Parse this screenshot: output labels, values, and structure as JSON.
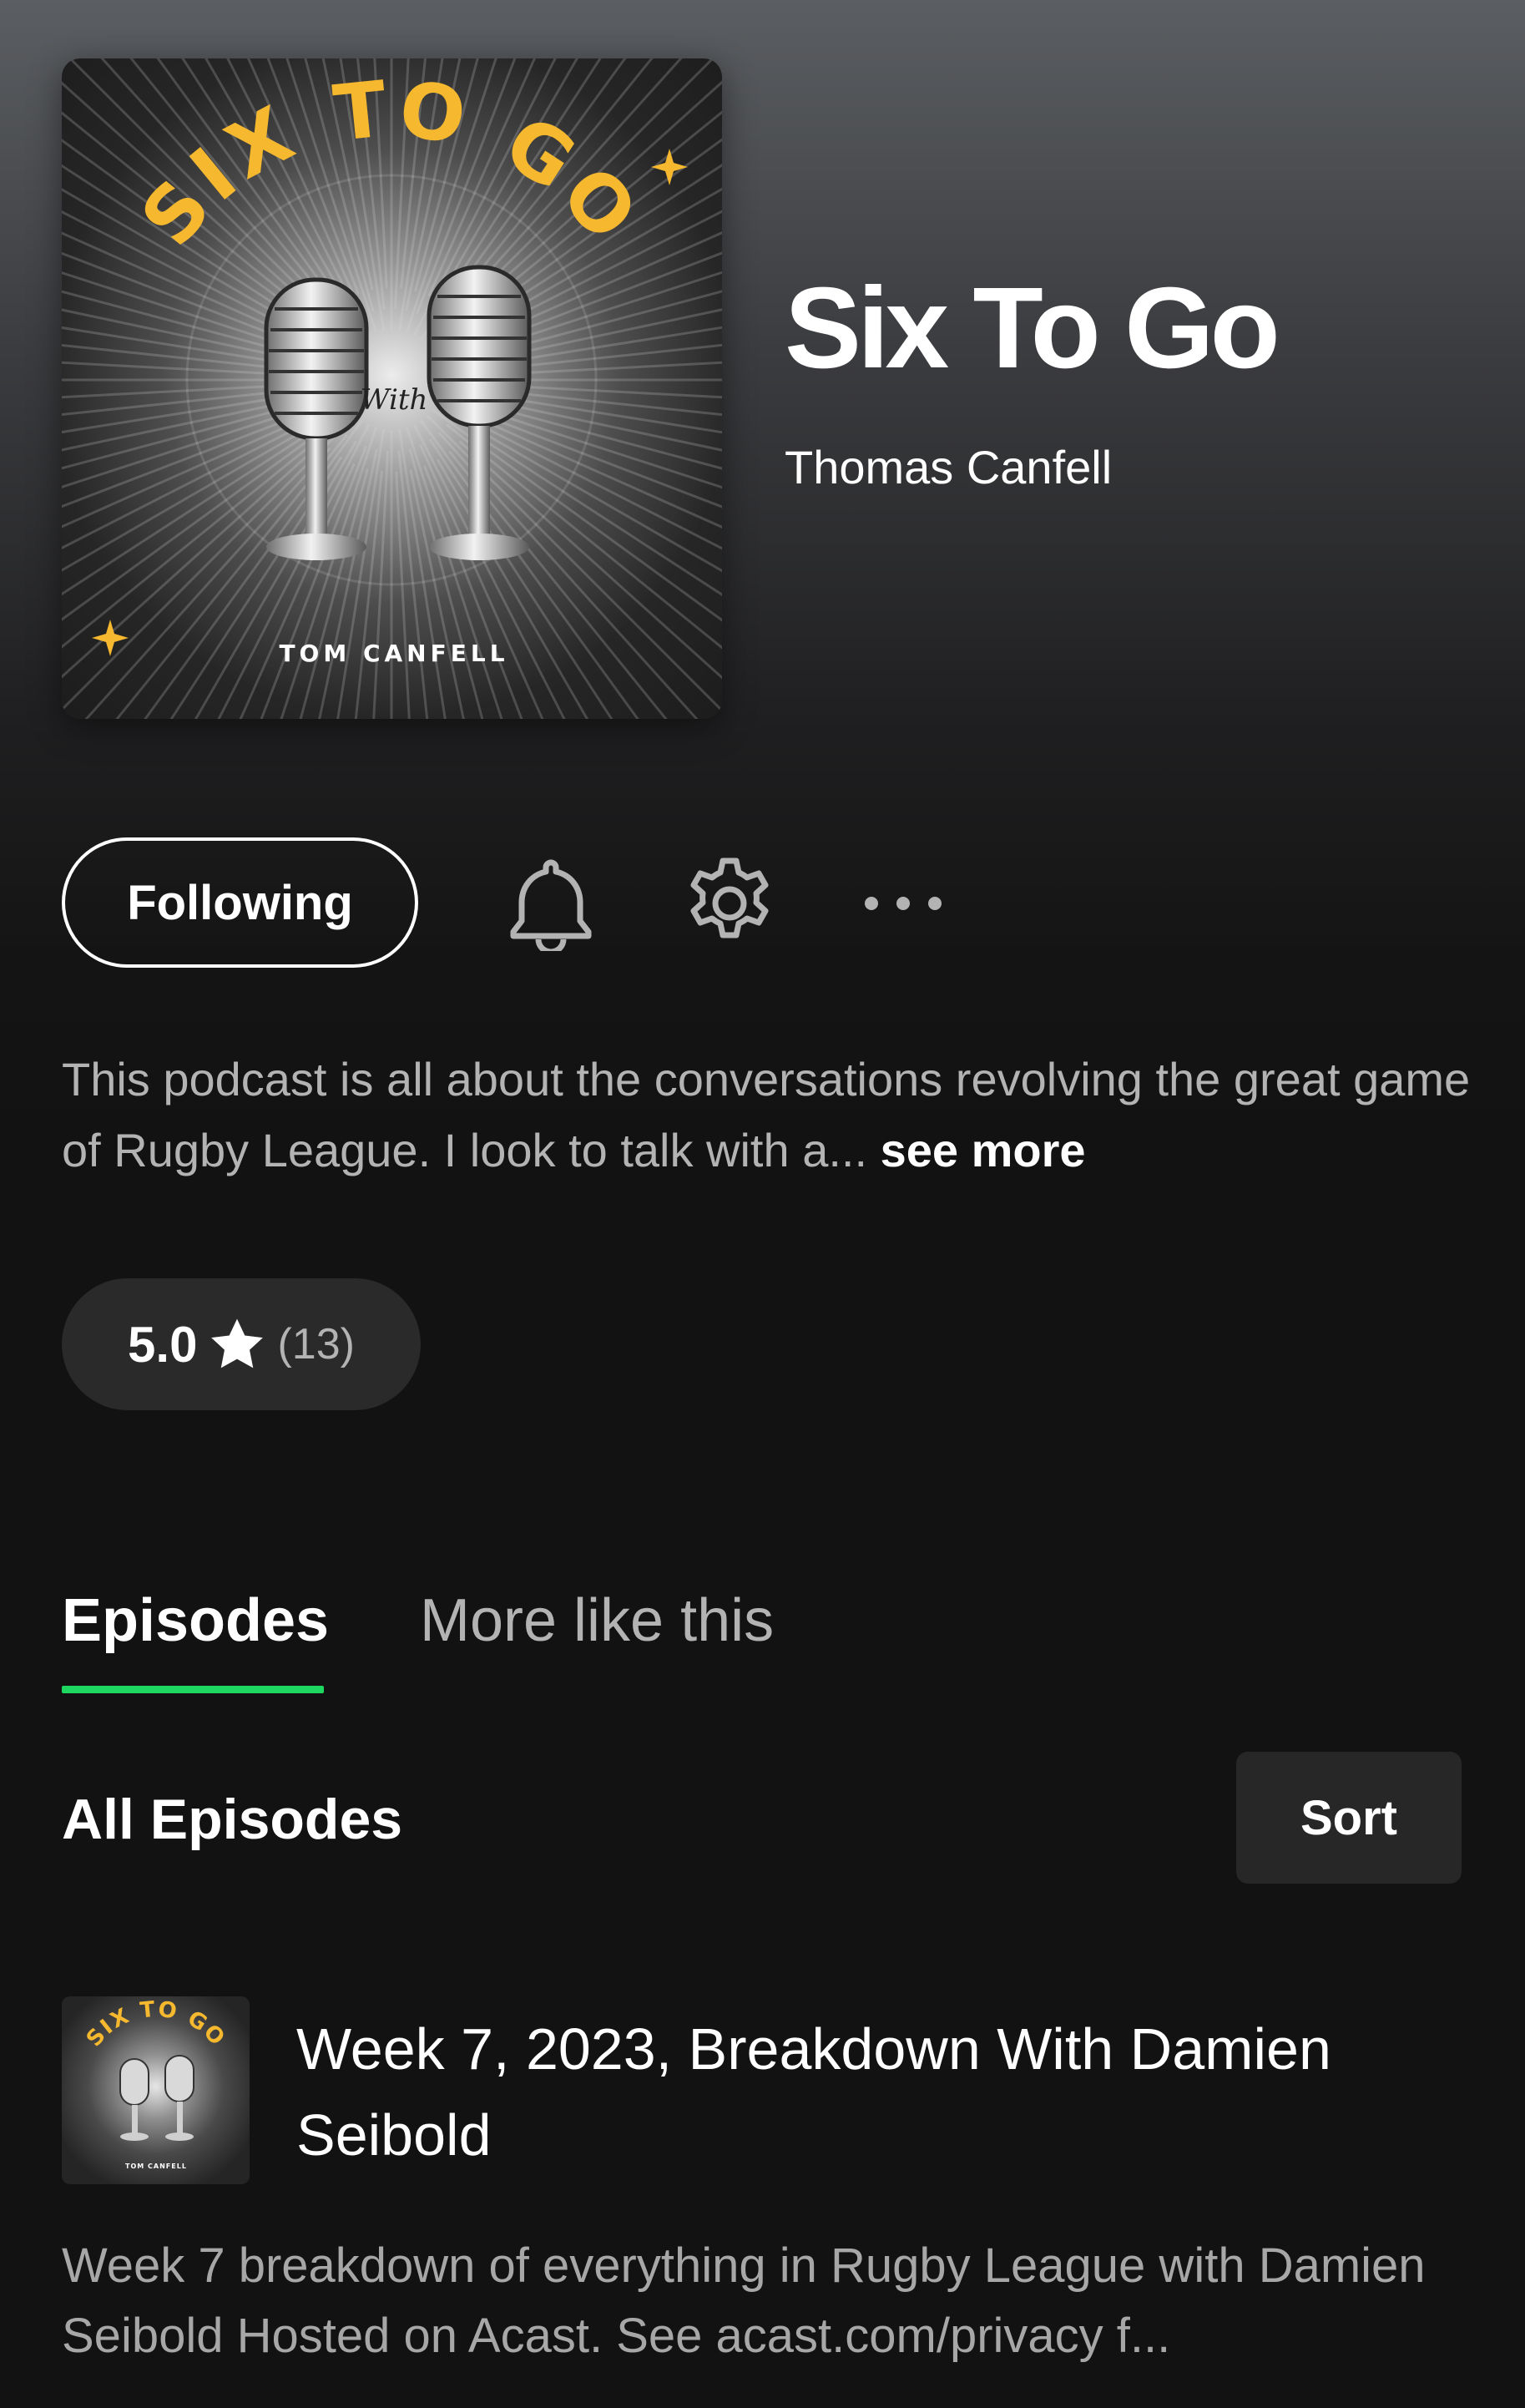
{
  "podcast": {
    "title": "Six To Go",
    "author": "Thomas Canfell",
    "cover_art": {
      "arc_text": "SIX TO GO",
      "script_text": "With",
      "bottom_text": "TOM CANFELL"
    }
  },
  "actions": {
    "follow_label": "Following",
    "bell_icon": "bell-icon",
    "settings_icon": "gear-icon",
    "more_icon": "more-horizontal-icon"
  },
  "description": {
    "text": "This podcast is all about the conversations revolving the great game of Rugby League. I look to talk with a...",
    "see_more": "see more"
  },
  "rating": {
    "value": "5.0",
    "count": "(13)",
    "icon": "star-icon"
  },
  "tabs": [
    {
      "label": "Episodes",
      "active": true
    },
    {
      "label": "More like this",
      "active": false
    }
  ],
  "episodes_section": {
    "title": "All Episodes",
    "sort_label": "Sort"
  },
  "episodes": [
    {
      "title": "Week 7, 2023, Breakdown With Damien Seibold",
      "description": "Week 7 breakdown of everything in Rugby League with Damien Seibold Hosted on Acast. See acast.com/privacy f...",
      "thumb_arc_text": "SIX TO GO",
      "thumb_bottom_text": "TOM CANFELL"
    }
  ],
  "colors": {
    "accent_green": "#1ed760",
    "cover_yellow": "#f5b82e",
    "background": "#121212"
  }
}
